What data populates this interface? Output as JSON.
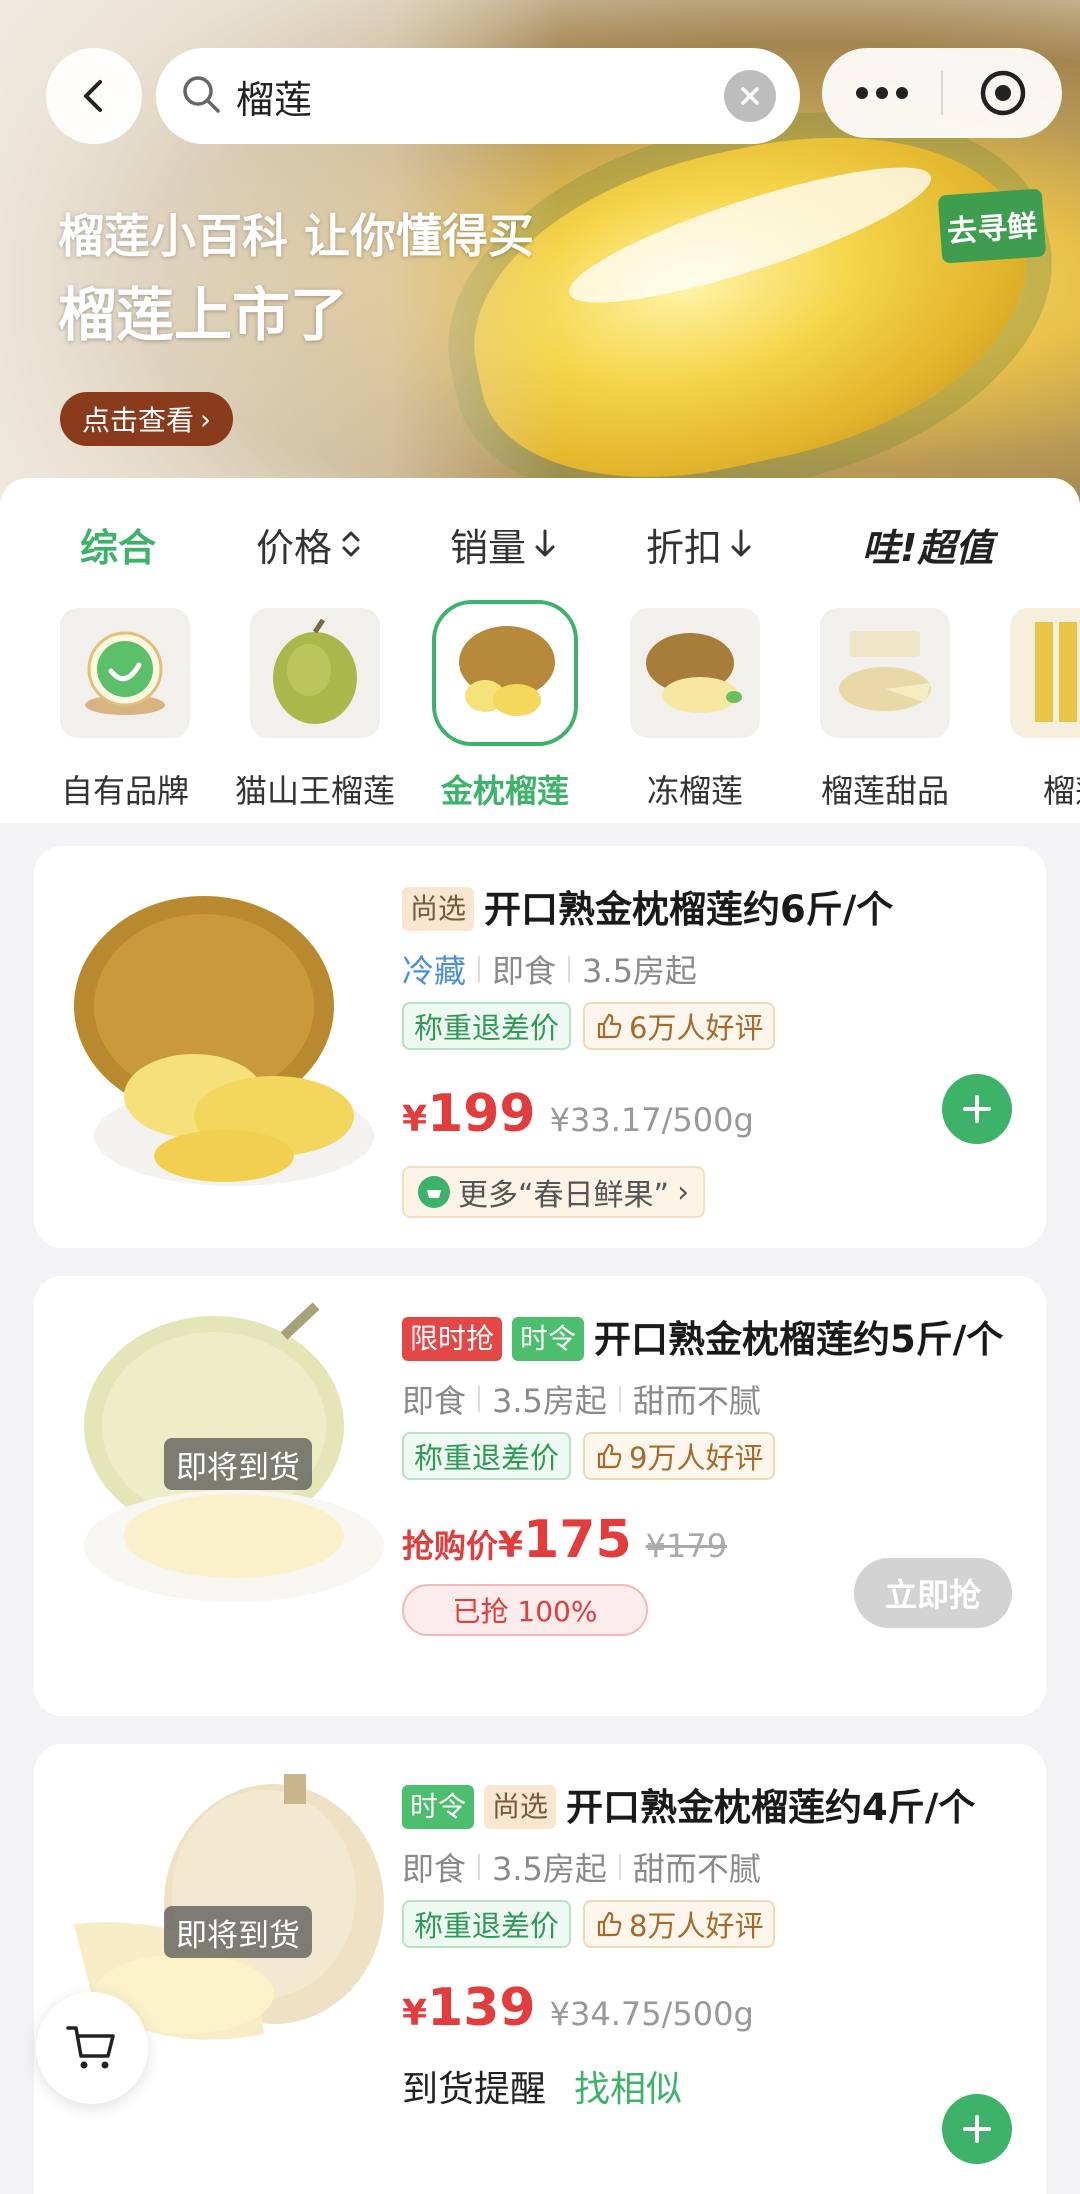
{
  "header": {
    "search_value": "榴莲",
    "banner_subtitle": "榴莲小百科 让你懂得买",
    "banner_title": "榴莲上市了",
    "banner_cta": "点击查看",
    "brand_logo_text": "去寻鲜"
  },
  "sort_bar": {
    "items": [
      {
        "label": "综合",
        "active": true
      },
      {
        "label": "价格",
        "icon": "sort-updown-icon"
      },
      {
        "label": "销量",
        "icon": "arrow-down-icon"
      },
      {
        "label": "折扣",
        "icon": "arrow-down-icon"
      },
      {
        "label": "哇!超值"
      }
    ]
  },
  "categories": [
    {
      "label": "自有品牌"
    },
    {
      "label": "猫山王榴莲"
    },
    {
      "label": "金枕榴莲",
      "active": true
    },
    {
      "label": "冻榴莲"
    },
    {
      "label": "榴莲甜品"
    },
    {
      "label": "榴莲"
    }
  ],
  "products": [
    {
      "tags": [
        "尚选"
      ],
      "title": "开口熟金枕榴莲约6斤/个",
      "attrs": [
        "冷藏",
        "即食",
        "3.5房起"
      ],
      "badge_refund": "称重退差价",
      "badge_reviews": "6万人好评",
      "currency": "¥",
      "price": "199",
      "unit_price": "¥33.17/500g",
      "more_link": "更多“春日鲜果”"
    },
    {
      "tags": [
        "限时抢",
        "时令"
      ],
      "title": "开口熟金枕榴莲约5斤/个",
      "attrs": [
        "即食",
        "3.5房起",
        "甜而不腻"
      ],
      "badge_refund": "称重退差价",
      "badge_reviews": "9万人好评",
      "image_overlay": "即将到货",
      "grab_label": "抢购价",
      "currency": "¥",
      "price": "175",
      "original_price": "¥179",
      "sold_progress": "已抢 100%",
      "buy_button": "立即抢"
    },
    {
      "tags": [
        "时令",
        "尚选"
      ],
      "title": "开口熟金枕榴莲约4斤/个",
      "attrs": [
        "即食",
        "3.5房起",
        "甜而不腻"
      ],
      "badge_refund": "称重退差价",
      "badge_reviews": "8万人好评",
      "image_overlay": "即将到货",
      "currency": "¥",
      "price": "139",
      "unit_price": "¥34.75/500g",
      "remind_button": "到货提醒",
      "similar_button": "找相似"
    }
  ],
  "colors": {
    "accent_green": "#3db36a",
    "price_red": "#e23c3c"
  }
}
